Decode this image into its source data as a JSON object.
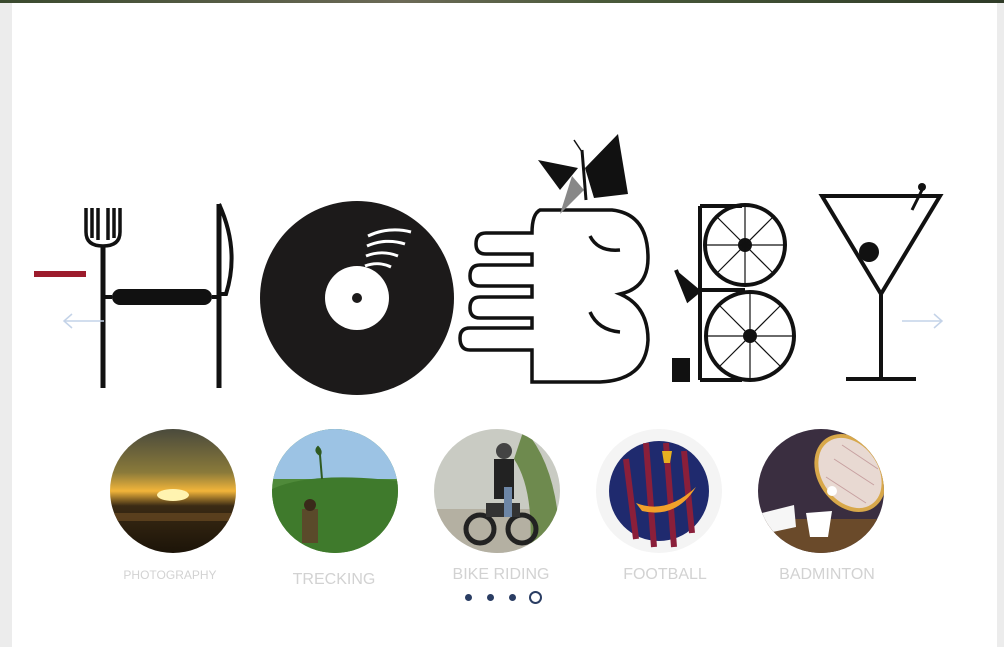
{
  "heading": {
    "word": "HOBBY"
  },
  "carousel": {
    "items": [
      {
        "label": "PHOTOGRAPHY",
        "icon": "sunset-photo"
      },
      {
        "label": "TRECKING",
        "icon": "trekking-photo"
      },
      {
        "label": "BIKE RIDING",
        "icon": "motorbike-photo"
      },
      {
        "label": "FOOTBALL",
        "icon": "football-photo"
      },
      {
        "label": "BADMINTON",
        "icon": "badminton-photo"
      }
    ],
    "page_count": 4,
    "active_page": 4
  },
  "colors": {
    "accent": "#9c1c2c",
    "dots": "#2a3d63",
    "label": "#d2d2d2"
  }
}
